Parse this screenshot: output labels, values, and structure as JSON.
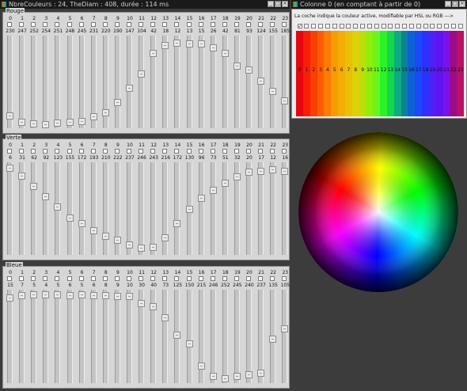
{
  "main_window": {
    "title": "NbreCouleurs : 24, TheDiam : 408, durée : 114 ms"
  },
  "panels": [
    {
      "name": "rouge",
      "label": "Rouge",
      "values": [
        230,
        247,
        252,
        254,
        251,
        248,
        245,
        231,
        220,
        190,
        147,
        104,
        42,
        18,
        12,
        13,
        15,
        26,
        42,
        81,
        93,
        124,
        155,
        185
      ]
    },
    {
      "name": "verte",
      "label": "Verte",
      "values": [
        6,
        31,
        62,
        92,
        123,
        155,
        172,
        193,
        210,
        222,
        237,
        246,
        243,
        216,
        172,
        130,
        96,
        73,
        51,
        32,
        20,
        17,
        12,
        16
      ]
    },
    {
      "name": "bleue",
      "label": "Bleue",
      "values": [
        15,
        7,
        5,
        4,
        5,
        6,
        5,
        6,
        8,
        9,
        10,
        30,
        40,
        73,
        125,
        150,
        215,
        246,
        252,
        245,
        240,
        237,
        135,
        105
      ]
    }
  ],
  "colonne_window": {
    "title": "Colonne 0 (en comptant à partir de 0)",
    "hint": "La coche indique la couleur active, modifiable par HSL ou RGB --->",
    "active_index": 0,
    "check_mark": "✓",
    "labels": [
      "0",
      "1",
      "2",
      "3",
      "4",
      "5",
      "6",
      "7",
      "8",
      "9",
      "10",
      "11",
      "12",
      "13",
      "14",
      "15",
      "16",
      "17",
      "18",
      "19",
      "20",
      "21",
      "22",
      "23"
    ]
  },
  "window_buttons": {
    "minimize": "_",
    "maximize": "□",
    "close": "×"
  },
  "colors": {
    "titlebar": "#1a1a1a",
    "panel": "#d6d6d6",
    "background": "#3c3c3c"
  }
}
